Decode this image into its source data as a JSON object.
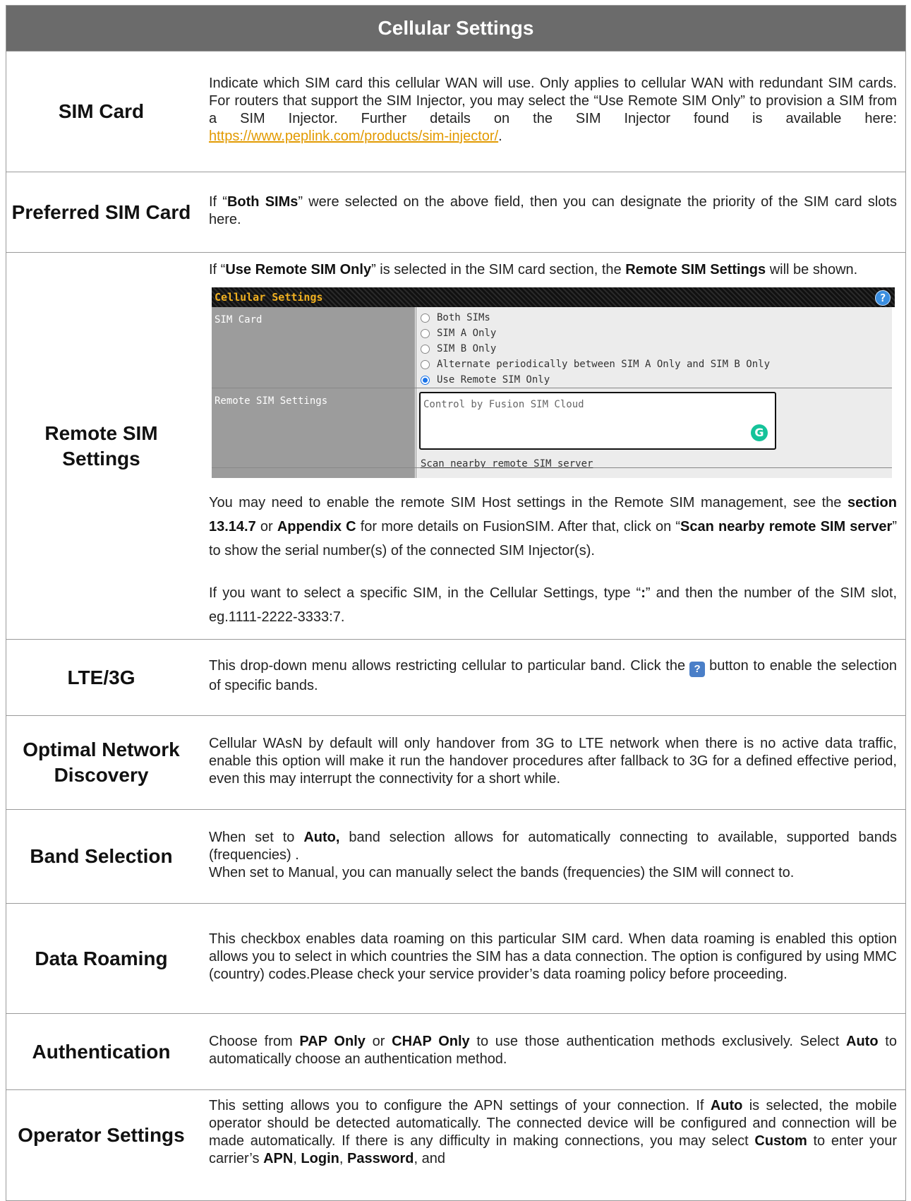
{
  "header": {
    "title": "Cellular Settings"
  },
  "rows": {
    "sim_card": {
      "label": "SIM Card",
      "text": "Indicate which SIM card this cellular WAN will use. Only applies to cellular WAN with redundant SIM cards. For routers that support the SIM Injector, you may select the “Use Remote SIM Only” to provision a SIM from a SIM Injector. Further details on the SIM Injector found is available here: ",
      "link": "https://www.peplink.com/products/sim-injector/",
      "text_end": "."
    },
    "preferred_sim": {
      "label": "Preferred SIM Card",
      "t1": "If “",
      "b1": "Both SIMs",
      "t2": "” were selected on the above field, then you can designate the priority of the SIM card slots here."
    },
    "remote_sim": {
      "label": "Remote SIM Settings",
      "p1_t1": "If “",
      "p1_b1": "Use Remote SIM Only",
      "p1_t2": "” is selected in the SIM card section, the ",
      "p1_b2": "Remote SIM Settings",
      "p1_t3": " will be shown.",
      "p2_t1": "You may need to enable the remote SIM Host settings in the Remote SIM management, see the ",
      "p2_b1": "section 13.14.7",
      "p2_t2": " or ",
      "p2_b2": "Appendix C",
      "p2_t3": " for more details on FusionSIM. After that, click on “",
      "p2_b3": "Scan nearby remote SIM server",
      "p2_t4": "” to show the serial number(s) of the connected SIM Injector(s).",
      "p3_t1": "If you want to select a specific SIM, in the Cellular Settings, type “",
      "p3_b1": ":",
      "p3_t2": "” and then the number of the SIM slot, eg.1111-2222-3333:7.",
      "screenshot": {
        "title": "Cellular Settings",
        "help": "?",
        "sim_label": "SIM Card",
        "options": [
          "Both SIMs",
          "SIM A Only",
          "SIM B Only",
          "Alternate periodically between SIM A Only and SIM B Only",
          "Use Remote SIM Only"
        ],
        "selected": "Use Remote SIM Only",
        "remote_label": "Remote SIM Settings",
        "textarea_placeholder": "Control by Fusion SIM Cloud",
        "grammarly": "G",
        "scan_link": "Scan nearby remote SIM server"
      }
    },
    "lte": {
      "label": "LTE/3G",
      "t1": "This drop-down menu allows restricting cellular to particular band. Click the",
      "icon": "?",
      "t2": "button to enable the selection of specific bands."
    },
    "optimal": {
      "label": "Optimal Network Discovery",
      "text": "Cellular WAsN by default will only handover from 3G to LTE network when there is no active data traffic, enable this option will make it run the handover procedures after fallback to 3G for a defined effective period, even this may interrupt the connectivity for a short while."
    },
    "band": {
      "label": "Band Selection",
      "t1": "When set to ",
      "b1": "Auto,",
      "t2": " band selection allows for automatically connecting to available, supported bands (frequencies) .",
      "t3": "When set to Manual, you can manually select the bands (frequencies) the SIM will connect to."
    },
    "roaming": {
      "label": "Data Roaming",
      "text": "This checkbox enables data roaming on this particular SIM card. When data roaming is enabled this option allows you to select in which countries the SIM has a data connection. The option is configured by using MMC (country) codes.Please check your service provider’s data roaming policy before proceeding."
    },
    "auth": {
      "label": "Authentication",
      "t1": "Choose from ",
      "b1": "PAP Only",
      "t2": " or ",
      "b2": "CHAP Only",
      "t3": " to use those authentication methods exclusively. Select ",
      "b3": "Auto",
      "t4": " to automatically choose an authentication method."
    },
    "operator": {
      "label": "Operator Settings",
      "t1": "This setting allows you to configure the APN settings of your connection. If ",
      "b1": "Auto",
      "t2": " is selected, the mobile operator should be detected automatically. The connected device will be configured and connection will be made automatically. If there is any difficulty in making connections, you may select ",
      "b2": "Custom",
      "t3": " to enter your carrier’s ",
      "b3": "APN",
      "t4": ", ",
      "b4": "Login",
      "t5": ", ",
      "b5": "Password",
      "t6": ", and"
    }
  }
}
